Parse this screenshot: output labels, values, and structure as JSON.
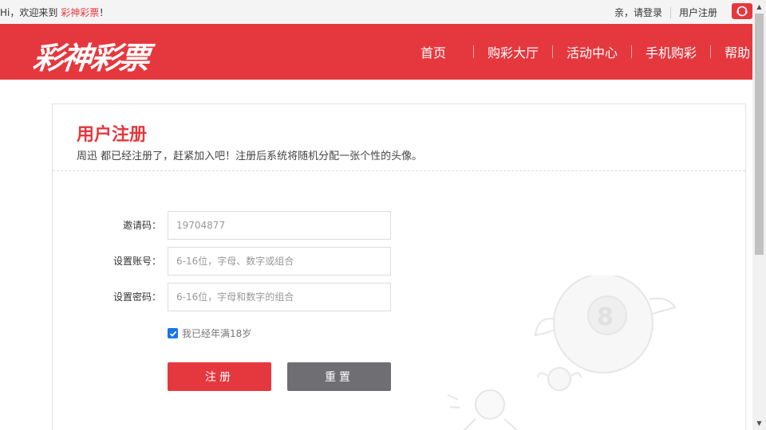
{
  "topbar": {
    "greeting_prefix": "Hi，欢迎来到 ",
    "brand": "彩神彩票",
    "greeting_suffix": "！",
    "login_link": "亲，请登录",
    "register_link": "用户注册",
    "service_icon": "customer-service-icon"
  },
  "header": {
    "logo_text": "彩神彩票",
    "nav": [
      "首页",
      "购彩大厅",
      "活动中心",
      "手机购彩",
      "帮助"
    ]
  },
  "form": {
    "title": "用户注册",
    "subtitle": "周迅 都已经注册了，赶紧加入吧！注册后系统将随机分配一张个性的头像。",
    "invite_label": "邀请码：",
    "invite_value": "19704877",
    "account_label": "设置账号：",
    "account_placeholder": "6-16位，字母、数字或组合",
    "password_label": "设置密码：",
    "password_placeholder": "6-16位，字母和数字的组合",
    "age_confirm": "我已经年满18岁",
    "age_checked": true,
    "submit_label": "注册",
    "reset_label": "重置"
  },
  "colors": {
    "brand_red": "#e5383e",
    "reset_gray": "#6f6e73",
    "checkbox_blue": "#1a73e8"
  }
}
